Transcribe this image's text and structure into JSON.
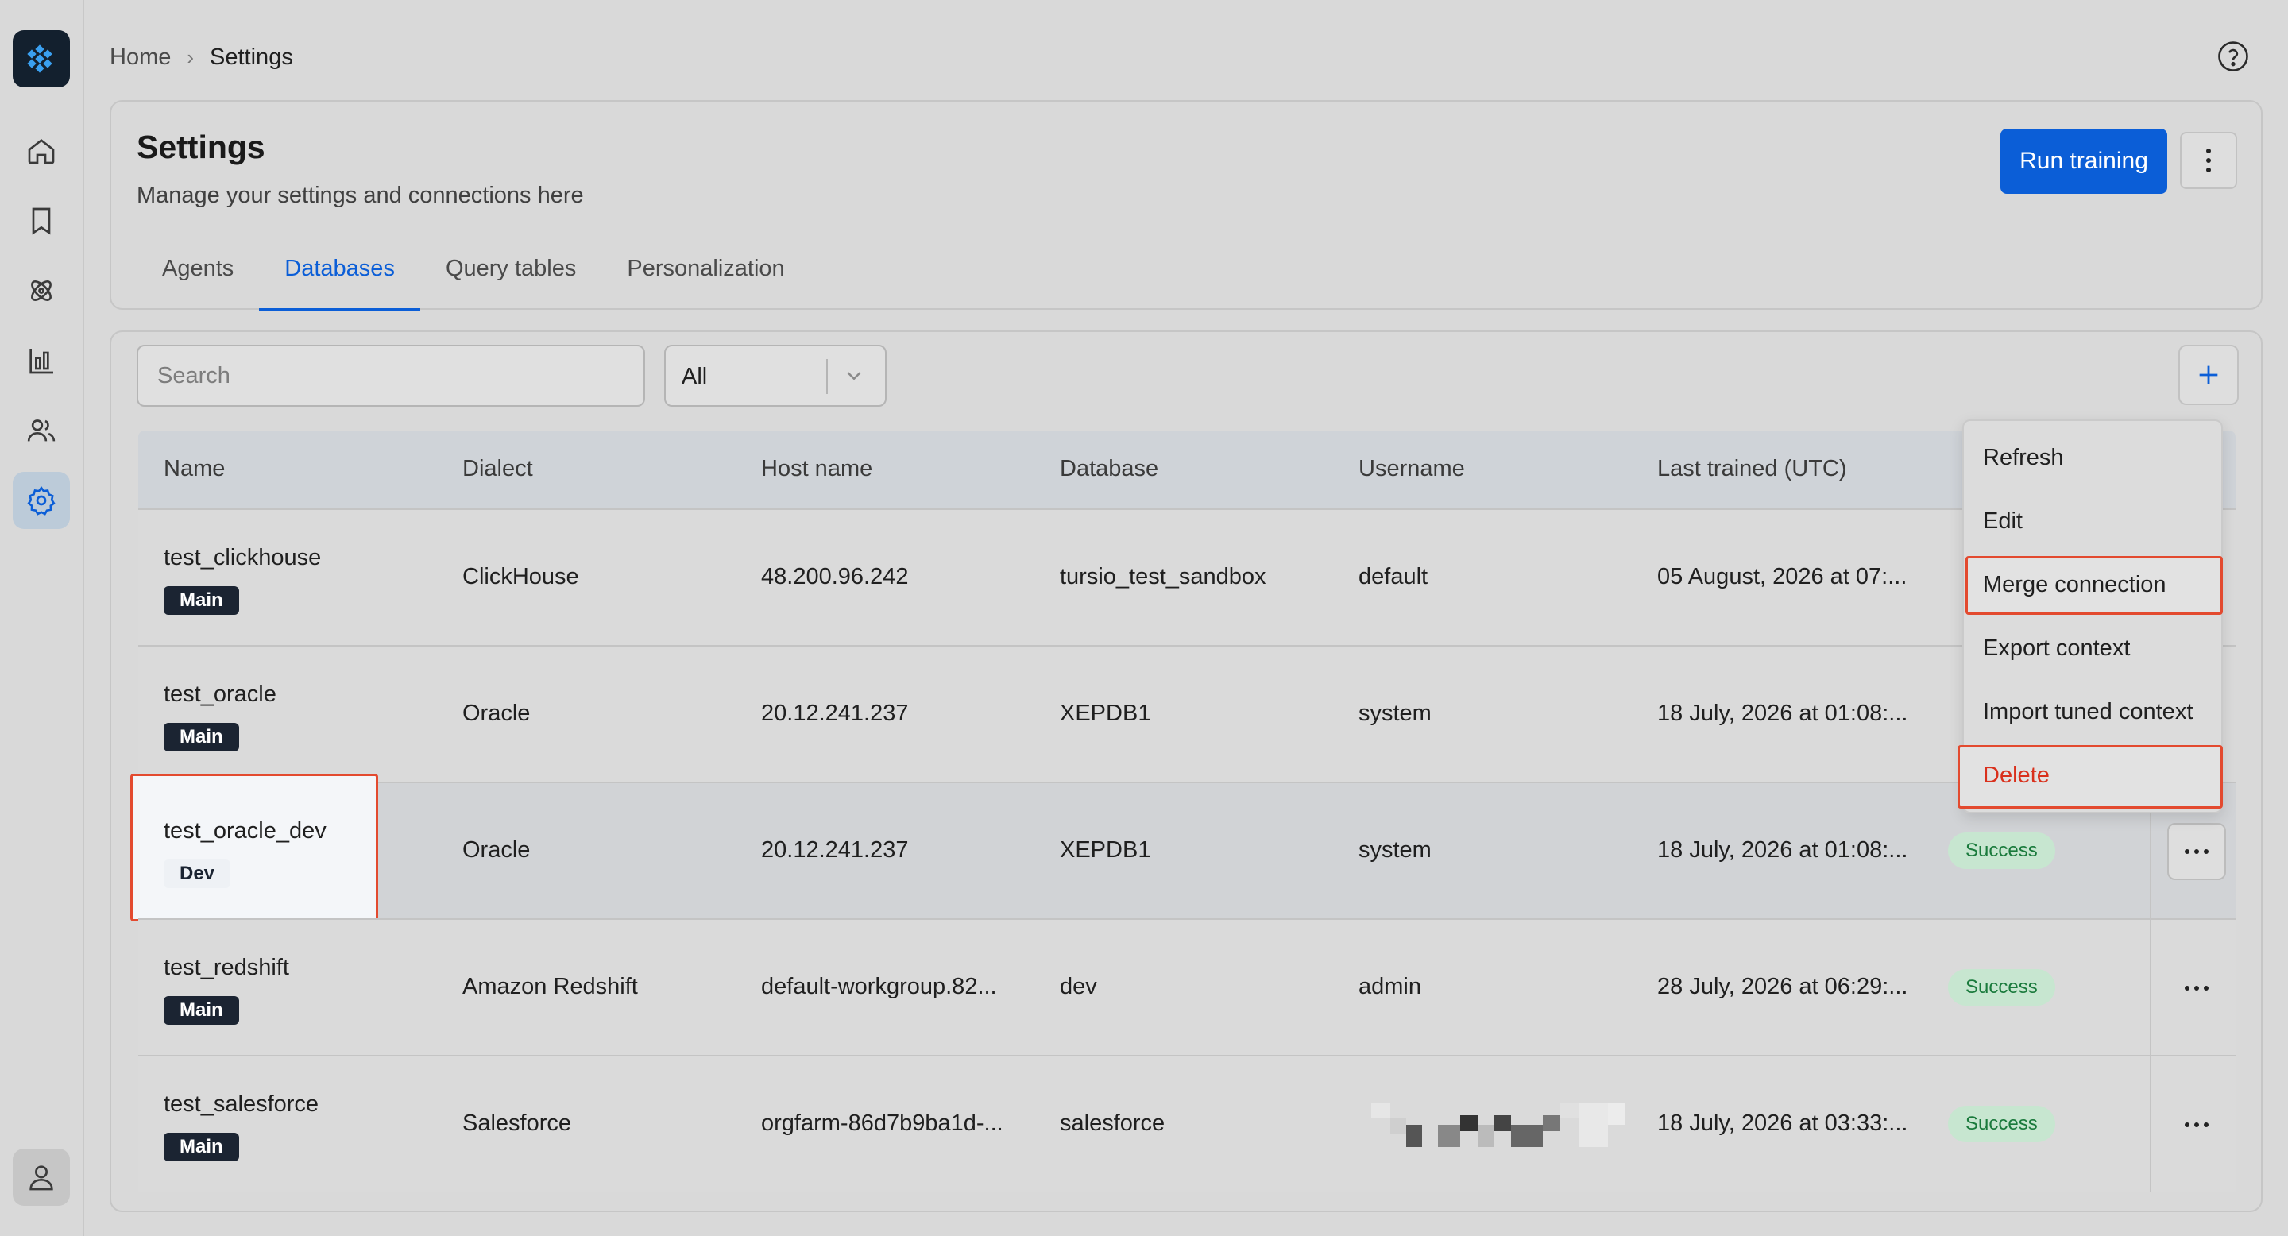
{
  "breadcrumb": {
    "home": "Home",
    "separator": "›",
    "current": "Settings"
  },
  "settings": {
    "title": "Settings",
    "subtitle": "Manage your settings and connections here",
    "run_training": "Run training",
    "tabs": [
      "Agents",
      "Databases",
      "Query tables",
      "Personalization"
    ],
    "active_tab": "Databases"
  },
  "toolbar": {
    "search_placeholder": "Search",
    "filter_value": "All"
  },
  "table": {
    "headers": [
      "Name",
      "Dialect",
      "Host name",
      "Database",
      "Username",
      "Last trained (UTC)"
    ],
    "rows": [
      {
        "name": "test_clickhouse",
        "badge": "Main",
        "dialect": "ClickHouse",
        "host": "48.200.96.242",
        "database": "tursio_test_sandbox",
        "username": "default",
        "last_trained": "05 August, 2026 at 07:...",
        "status": ""
      },
      {
        "name": "test_oracle",
        "badge": "Main",
        "dialect": "Oracle",
        "host": "20.12.241.237",
        "database": "XEPDB1",
        "username": "system",
        "last_trained": "18 July, 2026 at 01:08:...",
        "status": ""
      },
      {
        "name": "test_oracle_dev",
        "badge": "Dev",
        "dialect": "Oracle",
        "host": "20.12.241.237",
        "database": "XEPDB1",
        "username": "system",
        "last_trained": "18 July, 2026 at 01:08:...",
        "status": "Success"
      },
      {
        "name": "test_redshift",
        "badge": "Main",
        "dialect": "Amazon Redshift",
        "host": "default-workgroup.82...",
        "database": "dev",
        "username": "admin",
        "last_trained": "28 July, 2026 at 06:29:...",
        "status": "Success"
      },
      {
        "name": "test_salesforce",
        "badge": "Main",
        "dialect": "Salesforce",
        "host": "orgfarm-86d7b9ba1d-...",
        "database": "salesforce",
        "username": "",
        "last_trained": "18 July, 2026 at 03:33:...",
        "status": "Success"
      }
    ]
  },
  "context_menu": {
    "items": [
      "Refresh",
      "Edit",
      "Merge connection",
      "Export context",
      "Import tuned context",
      "Delete"
    ]
  },
  "colors": {
    "primary": "#0b5ed7",
    "highlight": "#e34a2f",
    "danger": "#d9301c",
    "success_bg": "#c7e6d0",
    "success_text": "#1a7a3c"
  }
}
